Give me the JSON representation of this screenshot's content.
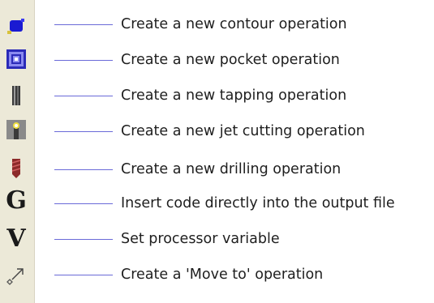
{
  "toolbar": {
    "items": [
      {
        "icon": "contour-icon",
        "label": "Create a new contour operation"
      },
      {
        "icon": "pocket-icon",
        "label": "Create a new pocket operation"
      },
      {
        "icon": "tapping-icon",
        "label": "Create a new tapping operation"
      },
      {
        "icon": "jet-cutting-icon",
        "label": "Create a new jet cutting operation"
      },
      {
        "icon": "drilling-icon",
        "label": "Create a new drilling operation"
      },
      {
        "icon": "g-code-icon",
        "glyph": "G",
        "label": "Insert code directly into the output file"
      },
      {
        "icon": "variable-icon",
        "glyph": "V",
        "label": "Set processor variable"
      },
      {
        "icon": "move-to-icon",
        "label": "Create a 'Move to' operation"
      }
    ]
  },
  "colors": {
    "toolbar_bg": "#ece9d8",
    "connector": "#6a6ad8",
    "contour_icon": "#1a1ad2",
    "drilling_icon": "#8c2a2a"
  }
}
